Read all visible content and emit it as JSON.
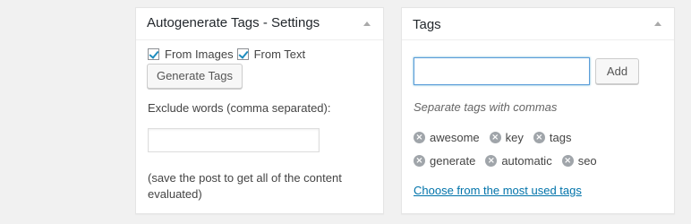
{
  "settings_box": {
    "title": "Autogenerate Tags - Settings",
    "from_images_label": "From Images",
    "from_text_label": "From Text",
    "generate_button": "Generate Tags",
    "exclude_label": "Exclude words (comma separated):",
    "exclude_value": "",
    "note": "(save the post to get all of the content evaluated)"
  },
  "tags_box": {
    "title": "Tags",
    "input_value": "",
    "add_button": "Add",
    "hint": "Separate tags with commas",
    "tags_row1": [
      "awesome",
      "key",
      "tags"
    ],
    "tags_row2": [
      "generate",
      "automatic",
      "seo"
    ],
    "choose_link": "Choose from the most used tags"
  },
  "colors": {
    "link": "#0073aa",
    "focus_border": "#5b9dd9",
    "checkmark": "#1e8cbe"
  }
}
